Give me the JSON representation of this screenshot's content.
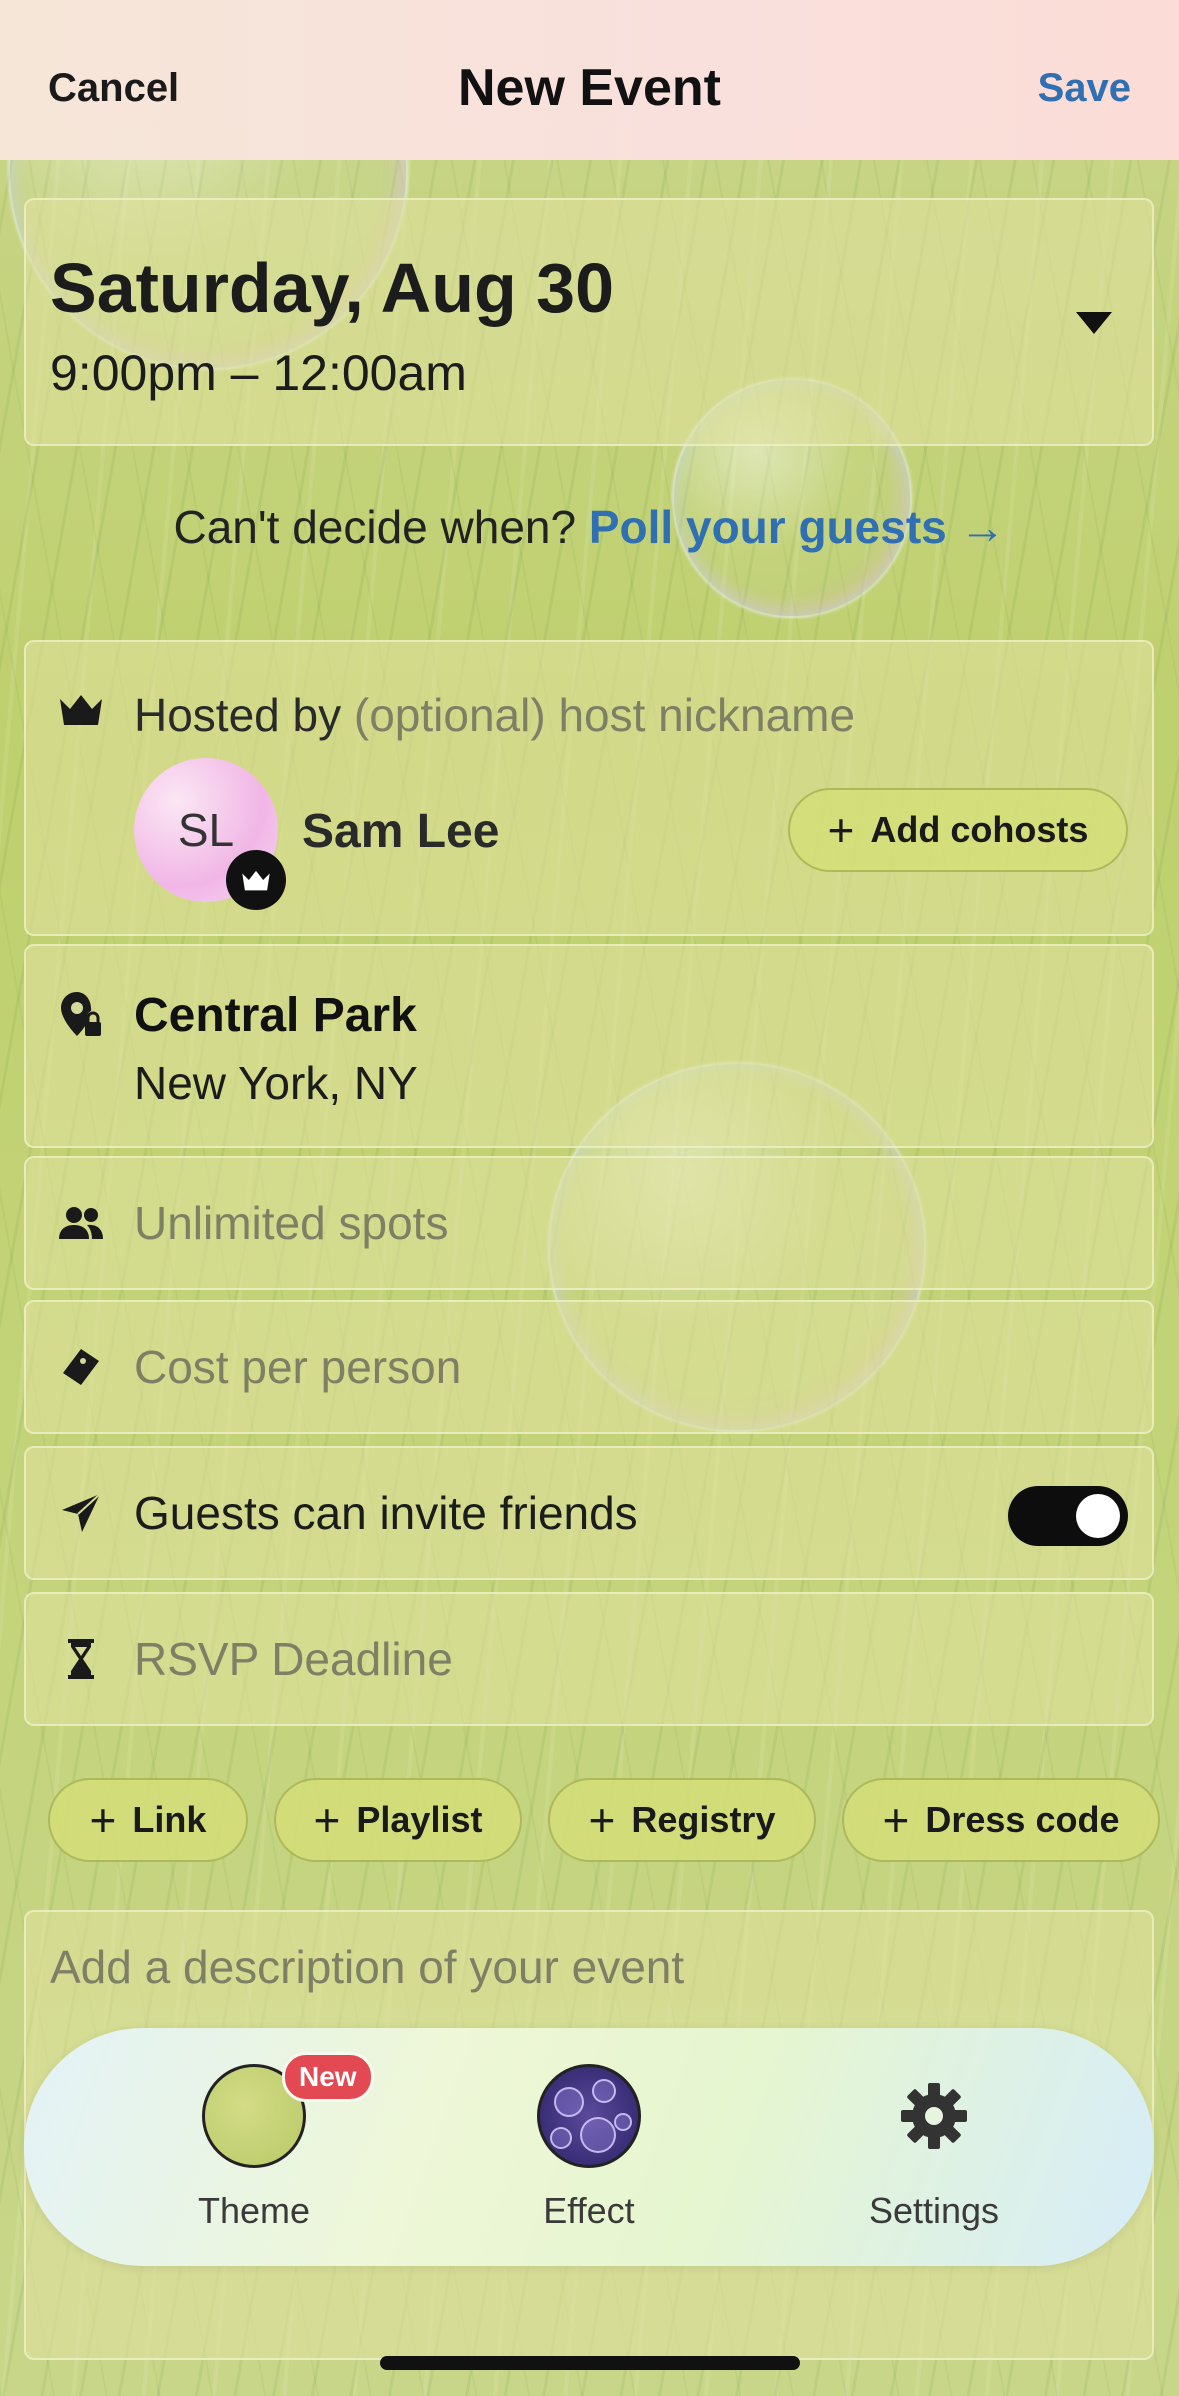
{
  "header": {
    "cancel_label": "Cancel",
    "title": "New Event",
    "save_label": "Save"
  },
  "date": {
    "day_label": "Saturday, Aug 30",
    "time_range": "9:00pm – 12:00am"
  },
  "poll": {
    "prompt": "Can't decide when?",
    "link_label": "Poll your guests →"
  },
  "host": {
    "label": "Hosted by",
    "nickname_placeholder": "(optional) host nickname",
    "avatar_initials": "SL",
    "name": "Sam Lee",
    "add_cohosts_label": "Add cohosts"
  },
  "location": {
    "name": "Central Park",
    "city": "New York, NY"
  },
  "spots": {
    "placeholder": "Unlimited spots"
  },
  "cost": {
    "placeholder": "Cost per person"
  },
  "invite": {
    "label": "Guests can invite friends",
    "enabled": true
  },
  "rsvp": {
    "placeholder": "RSVP Deadline"
  },
  "chips": [
    {
      "label": "Link"
    },
    {
      "label": "Playlist"
    },
    {
      "label": "Registry"
    },
    {
      "label": "Dress code"
    }
  ],
  "description": {
    "placeholder": "Add a description of your event"
  },
  "dock": {
    "theme_label": "Theme",
    "new_badge": "New",
    "effect_label": "Effect",
    "settings_label": "Settings"
  },
  "colors": {
    "link_blue": "#2f6fb2",
    "badge_red": "#e34953",
    "toggle_on": "#0d0d0d"
  }
}
